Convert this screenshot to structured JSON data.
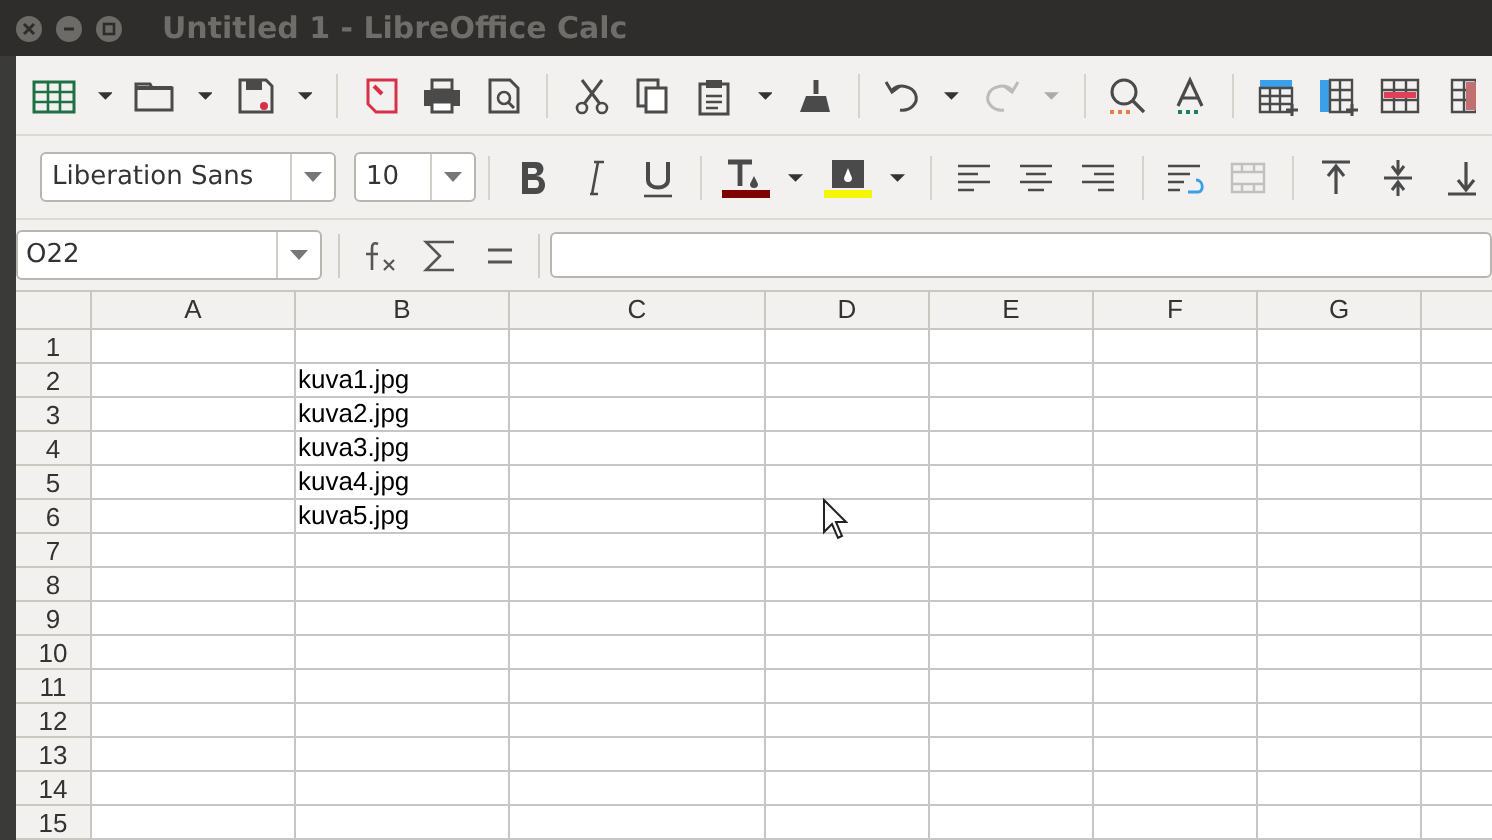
{
  "window": {
    "title": "Untitled 1 - LibreOffice Calc"
  },
  "formatting": {
    "font_name": "Liberation Sans",
    "font_size": "10"
  },
  "formula_bar": {
    "name_box": "O22"
  },
  "columns": [
    "A",
    "B",
    "C",
    "D",
    "E",
    "F",
    "G"
  ],
  "rows": [
    {
      "label": "1"
    },
    {
      "label": "2",
      "cells": [
        null,
        "kuva1.jpg"
      ]
    },
    {
      "label": "3",
      "cells": [
        null,
        "kuva2.jpg"
      ]
    },
    {
      "label": "4",
      "cells": [
        null,
        "kuva3.jpg"
      ]
    },
    {
      "label": "5",
      "cells": [
        null,
        "kuva4.jpg"
      ]
    },
    {
      "label": "6",
      "cells": [
        null,
        "kuva5.jpg"
      ]
    },
    {
      "label": "7"
    },
    {
      "label": "8"
    },
    {
      "label": "9"
    },
    {
      "label": "10"
    },
    {
      "label": "11"
    },
    {
      "label": "12"
    },
    {
      "label": "13"
    },
    {
      "label": "14"
    },
    {
      "label": "15"
    }
  ]
}
